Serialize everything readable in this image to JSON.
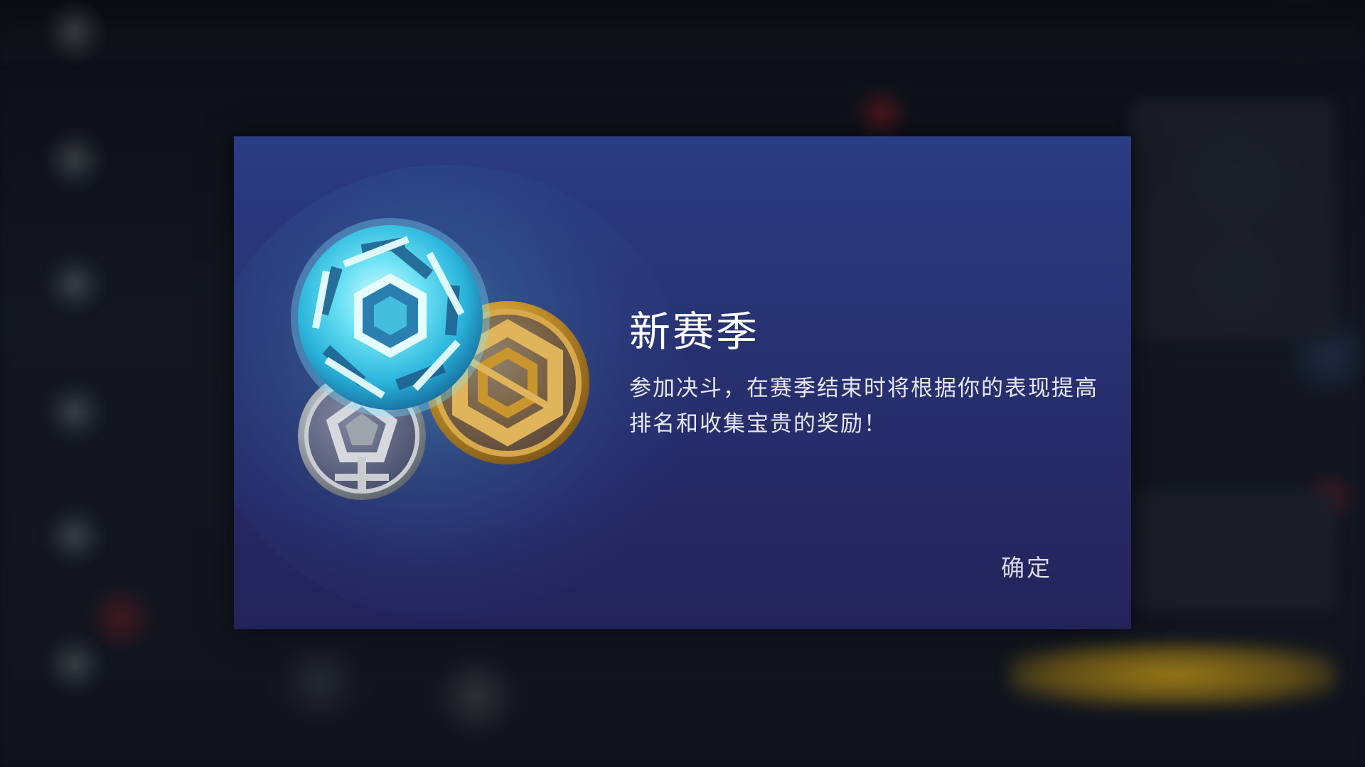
{
  "dialog": {
    "title": "新赛季",
    "description": "参加决斗，在赛季结束时将根据你的表现提高排名和收集宝贵的奖励！",
    "confirm_label": "确定",
    "art": {
      "icons": [
        "diamond-rank-orb-icon",
        "gold-rank-medal-icon",
        "silver-rank-medal-icon"
      ]
    }
  },
  "colors": {
    "dialog_top": "#2a3c83",
    "dialog_bottom": "#24225a",
    "diamond": "#4fd8f0",
    "gold": "#c9962e",
    "silver": "#9ea4ac"
  }
}
